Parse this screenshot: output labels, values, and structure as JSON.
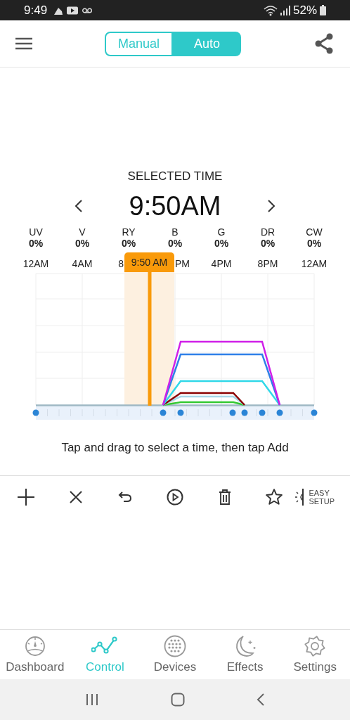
{
  "status_bar": {
    "time": "9:49",
    "battery": "52%"
  },
  "mode_toggle": [
    {
      "label": "Manual",
      "selected": false
    },
    {
      "label": "Auto",
      "selected": true
    }
  ],
  "selected_time": {
    "title": "SELECTED TIME",
    "time": "9:50AM"
  },
  "channels": [
    {
      "name": "UV",
      "value": "0%"
    },
    {
      "name": "V",
      "value": "0%"
    },
    {
      "name": "RY",
      "value": "0%"
    },
    {
      "name": "B",
      "value": "0%"
    },
    {
      "name": "G",
      "value": "0%"
    },
    {
      "name": "DR",
      "value": "0%"
    },
    {
      "name": "CW",
      "value": "0%"
    }
  ],
  "time_axis": [
    {
      "label": "12AM",
      "covered": false
    },
    {
      "label": "4AM",
      "covered": false
    },
    {
      "label": "8",
      "covered": true
    },
    {
      "label": "PM",
      "covered": true
    },
    {
      "label": "4PM",
      "covered": false
    },
    {
      "label": "8PM",
      "covered": false
    },
    {
      "label": "12AM",
      "covered": false
    }
  ],
  "time_marker": {
    "label": "9:50 AM"
  },
  "hint": "Tap and drag to select a time, then tap Add",
  "easy_setup": {
    "label": "EASY SETUP"
  },
  "bottom_nav": [
    {
      "label": "Dashboard",
      "selected": false
    },
    {
      "label": "Control",
      "selected": true
    },
    {
      "label": "Devices",
      "selected": false
    },
    {
      "label": "Effects",
      "selected": false
    },
    {
      "label": "Settings",
      "selected": false
    }
  ]
}
